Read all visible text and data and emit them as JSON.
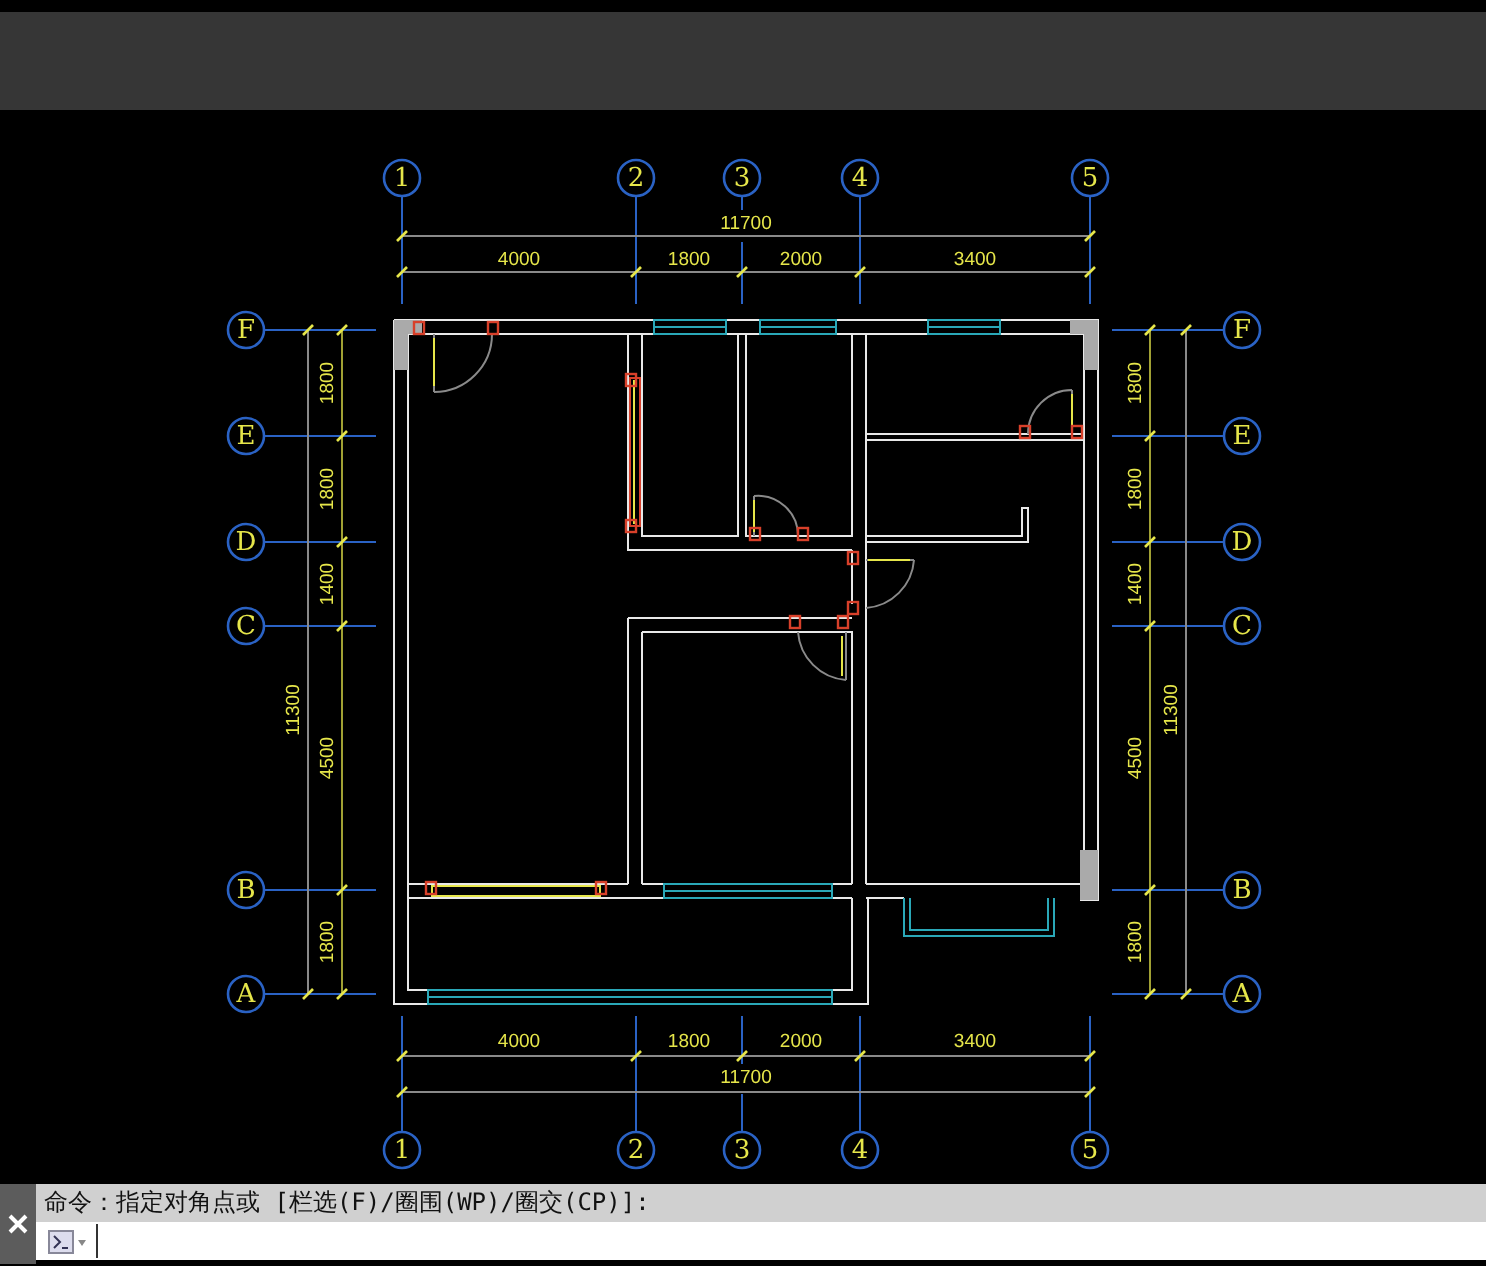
{
  "drawing": {
    "top_axes": [
      "1",
      "2",
      "3",
      "4",
      "5"
    ],
    "top_dimensions": {
      "total": "11700",
      "segments": [
        "4000",
        "1800",
        "2000",
        "3400"
      ]
    },
    "left_axes": [
      "F",
      "E",
      "D",
      "C",
      "B",
      "A"
    ],
    "left_dimensions": {
      "segments": [
        "1800",
        "1800",
        "1400",
        "4500",
        "1800"
      ],
      "total": "11300"
    },
    "right_axes": [
      "F",
      "E",
      "D",
      "C",
      "B",
      "A"
    ],
    "right_dimensions": {
      "segments": [
        "1800",
        "1800",
        "1400",
        "4500",
        "1800"
      ],
      "total": "11300"
    },
    "bottom_dimensions": {
      "segments": [
        "4000",
        "1800",
        "2000",
        "3400"
      ],
      "total": "11700"
    },
    "bottom_axes": [
      "1",
      "2",
      "3",
      "4",
      "5"
    ]
  },
  "command_line": {
    "history": "命令：指定对角点或 [栏选(F)/圈围(WP)/圈交(CP)]:"
  }
}
